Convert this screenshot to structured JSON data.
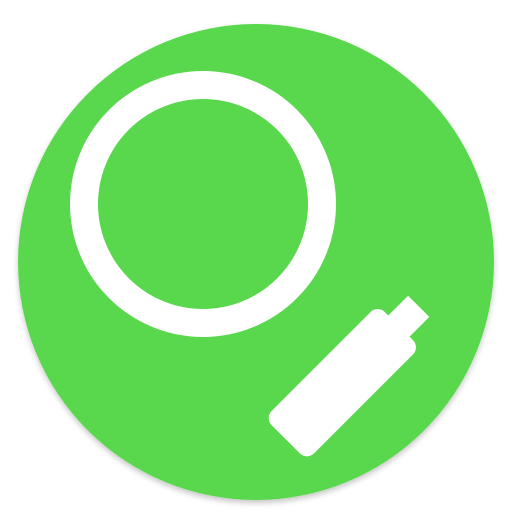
{
  "icon": {
    "name": "search-icon",
    "background_color": "#5ad84e",
    "glyph_color": "#ffffff"
  }
}
